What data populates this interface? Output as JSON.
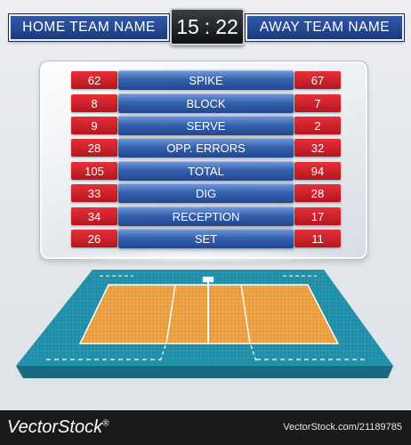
{
  "scoreboard": {
    "home_team": "HOME TEAM NAME",
    "away_team": "AWAY TEAM NAME",
    "clock_minutes": "15",
    "clock_seconds": "22"
  },
  "stats": [
    {
      "label": "SPIKE",
      "home": "62",
      "away": "67"
    },
    {
      "label": "BLOCK",
      "home": "8",
      "away": "7"
    },
    {
      "label": "SERVE",
      "home": "9",
      "away": "2"
    },
    {
      "label": "OPP. ERRORS",
      "home": "28",
      "away": "32"
    },
    {
      "label": "TOTAL",
      "home": "105",
      "away": "94"
    },
    {
      "label": "DIG",
      "home": "33",
      "away": "28"
    },
    {
      "label": "RECEPTION",
      "home": "34",
      "away": "17"
    },
    {
      "label": "SET",
      "home": "26",
      "away": "11"
    }
  ],
  "footer": {
    "brand": "VectorStock",
    "brand_mark": "®",
    "url": "VectorStock.com/21189785"
  },
  "colors": {
    "team_blue": "#1c3b80",
    "stat_red": "#c41d27",
    "court_orange": "#e89a38",
    "court_teal": "#1f8aa3"
  }
}
